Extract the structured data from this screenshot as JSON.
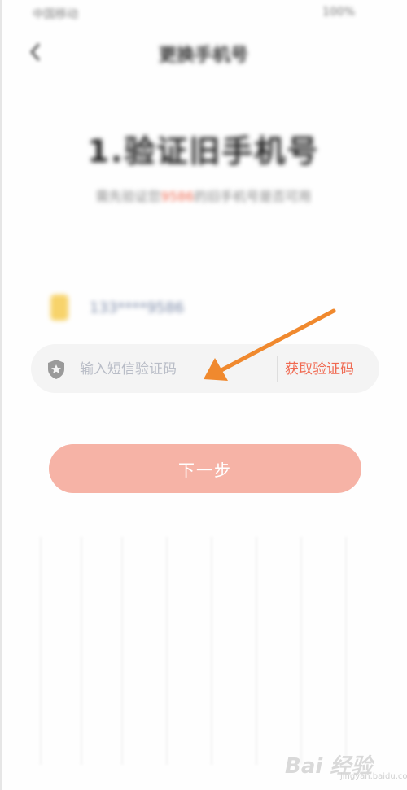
{
  "status_bar": {
    "left_text": "中国移动",
    "right_text": "100%"
  },
  "nav": {
    "title": "更换手机号"
  },
  "heading": {
    "title": "1.验证旧手机号",
    "subtitle_prefix": "需先验证您",
    "subtitle_highlight": "9586",
    "subtitle_suffix": "的旧手机号是否可用"
  },
  "phone": {
    "number": "133****9586"
  },
  "code_field": {
    "placeholder": "输入短信验证码",
    "get_code_label": "获取验证码"
  },
  "next_button": {
    "label": "下一步"
  },
  "watermark": {
    "brand": "Bai 经验",
    "domain": "jingyan.baidu.com"
  },
  "colors": {
    "accent": "#f06a52",
    "button_bg": "#f6b3a6",
    "input_bg": "#f4f4f4",
    "arrow": "#f0892e"
  }
}
